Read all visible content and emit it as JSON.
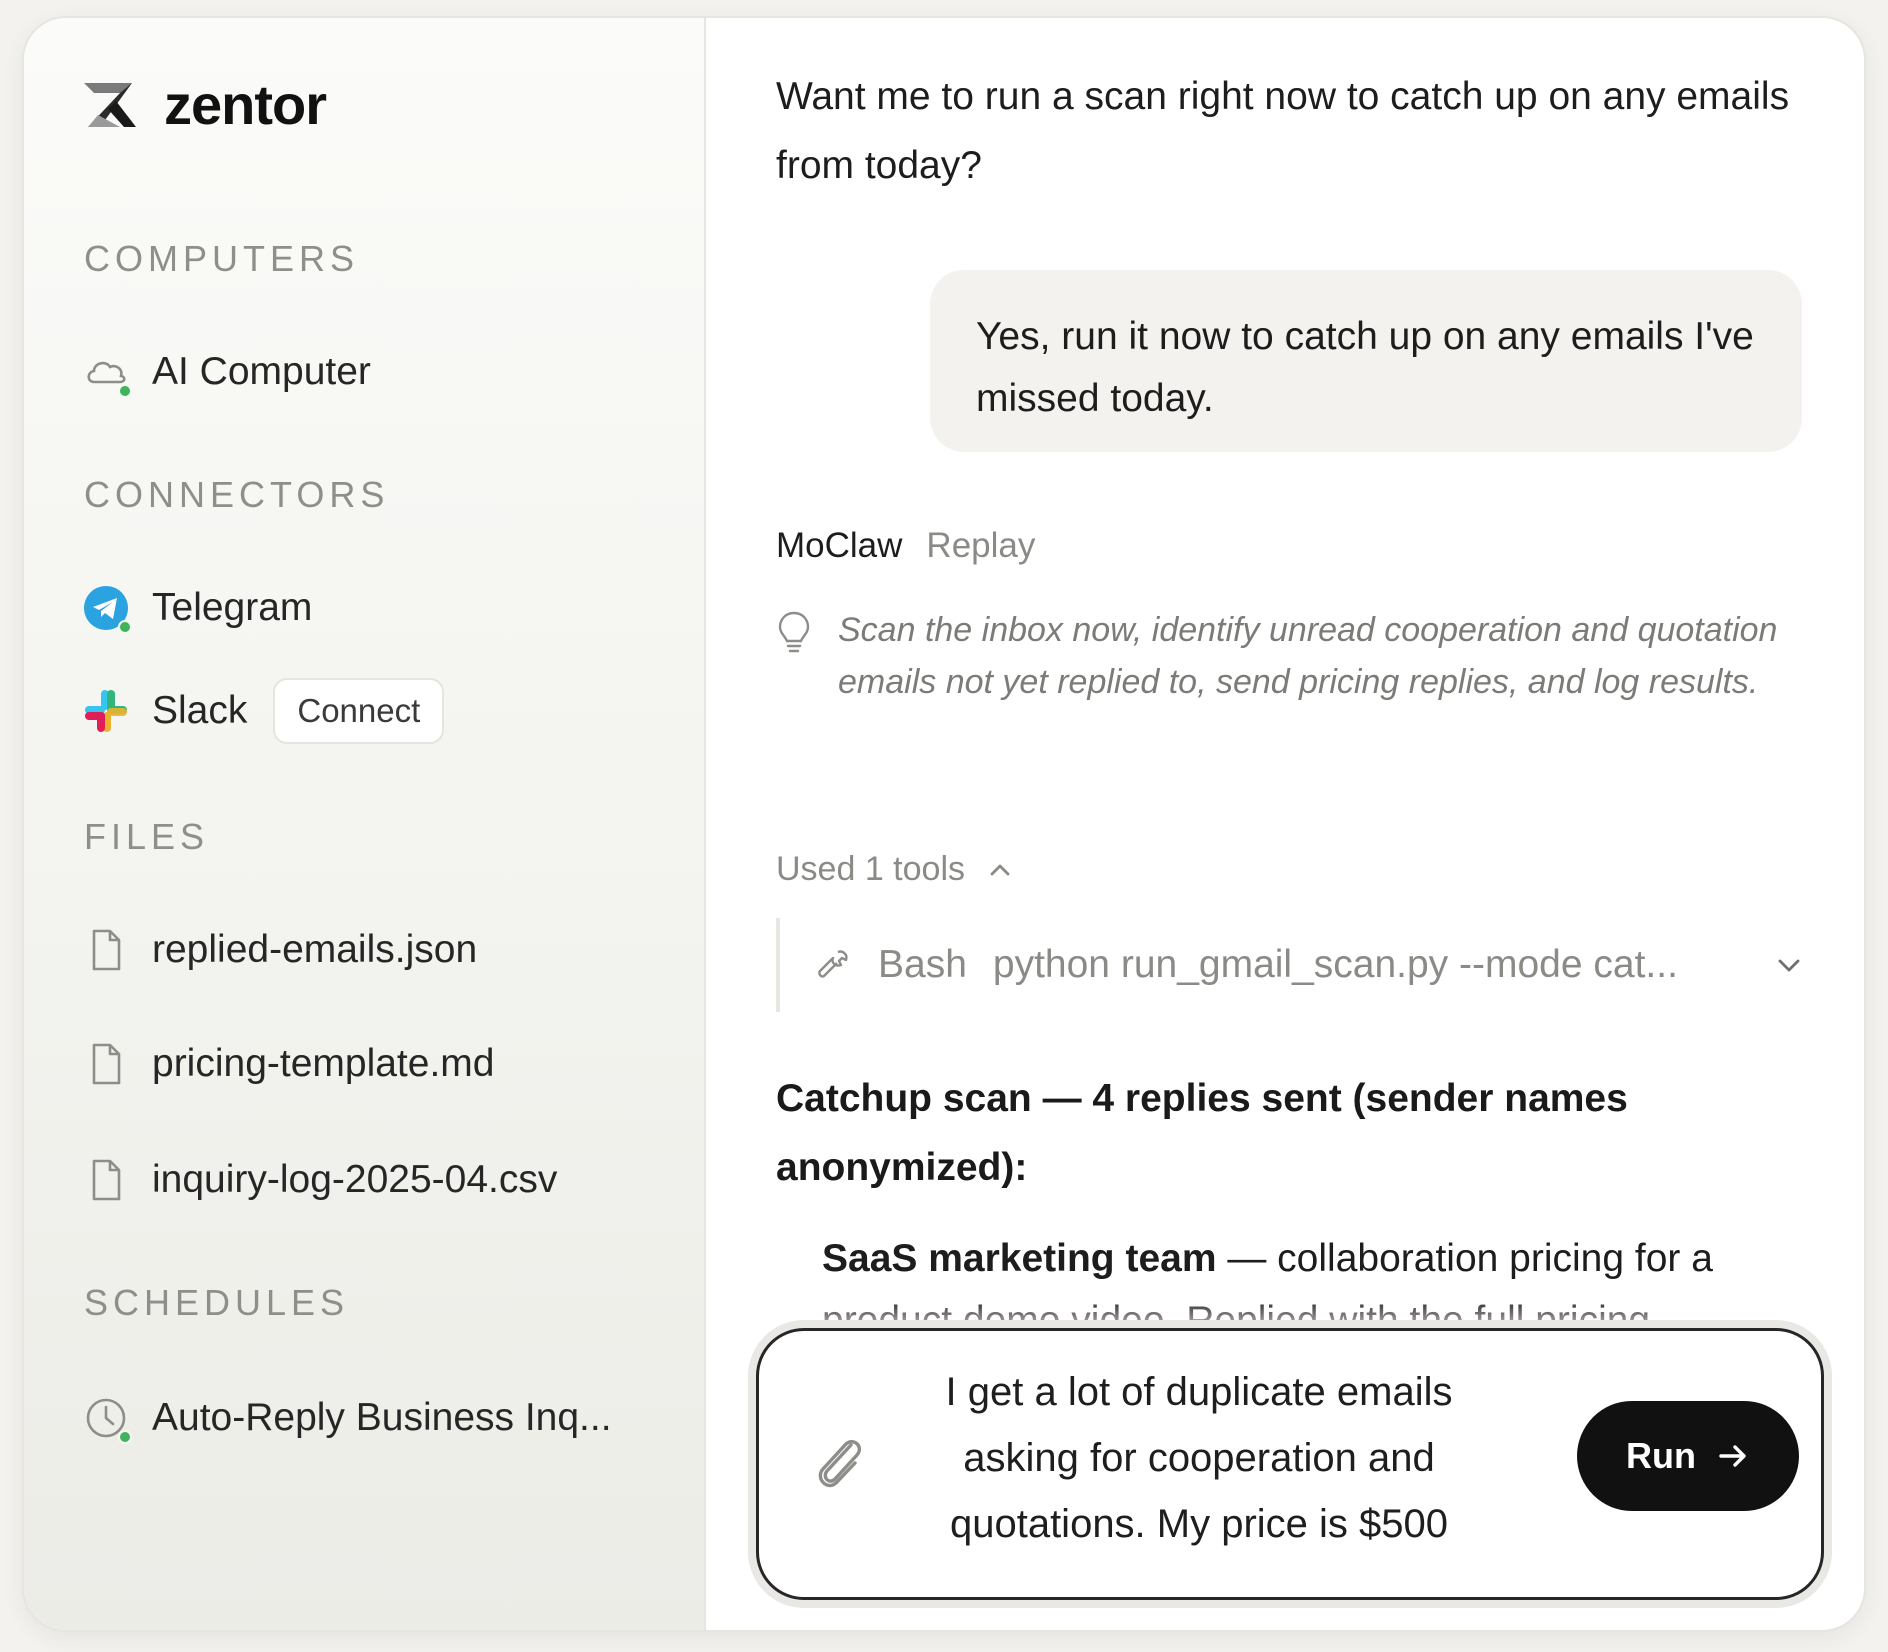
{
  "app": {
    "name": "zentor"
  },
  "sidebar": {
    "computers_title": "COMPUTERS",
    "computers": [
      {
        "label": "AI Computer",
        "icon": "cloud-icon",
        "status": "online"
      }
    ],
    "connectors_title": "CONNECTORS",
    "connectors": [
      {
        "label": "Telegram",
        "icon": "telegram-icon",
        "status": "connected"
      },
      {
        "label": "Slack",
        "icon": "slack-icon",
        "action_label": "Connect"
      }
    ],
    "files_title": "FILES",
    "files": [
      {
        "label": "replied-emails.json",
        "icon": "file-icon"
      },
      {
        "label": "pricing-template.md",
        "icon": "file-icon"
      },
      {
        "label": "inquiry-log-2025-04.csv",
        "icon": "file-icon"
      }
    ],
    "schedules_title": "SCHEDULES",
    "schedules": [
      {
        "label": "Auto-Reply Business Inq...",
        "icon": "clock-icon",
        "status": "active"
      }
    ]
  },
  "chat": {
    "assistant_prompt": "Want me to run a scan right now to catch up on any emails from today?",
    "user_message": "Yes, run it now to catch up on any emails I've missed today.",
    "agent_name": "MoClaw",
    "replay_label": "Replay",
    "thought": "Scan the inbox now, identify unread cooperation and quotation emails not yet replied to, send pricing replies, and log results.",
    "tools_used_label": "Used 1 tools",
    "tool": {
      "name": "Bash",
      "command": "python run_gmail_scan.py --mode cat..."
    },
    "summary_title": "Catchup scan — 4 replies sent (sender names anonymized):",
    "summary_item_bold": "SaaS marketing team",
    "summary_item_rest": " — collaboration pricing for a product demo video. Replied with the full pricing"
  },
  "composer": {
    "input_text": "I get a lot of duplicate emails asking for cooperation and quotations. My price is $500",
    "run_label": "Run"
  },
  "colors": {
    "status_green": "#3fb45b",
    "telegram_blue": "#2aa3e0",
    "run_button": "#111111"
  }
}
